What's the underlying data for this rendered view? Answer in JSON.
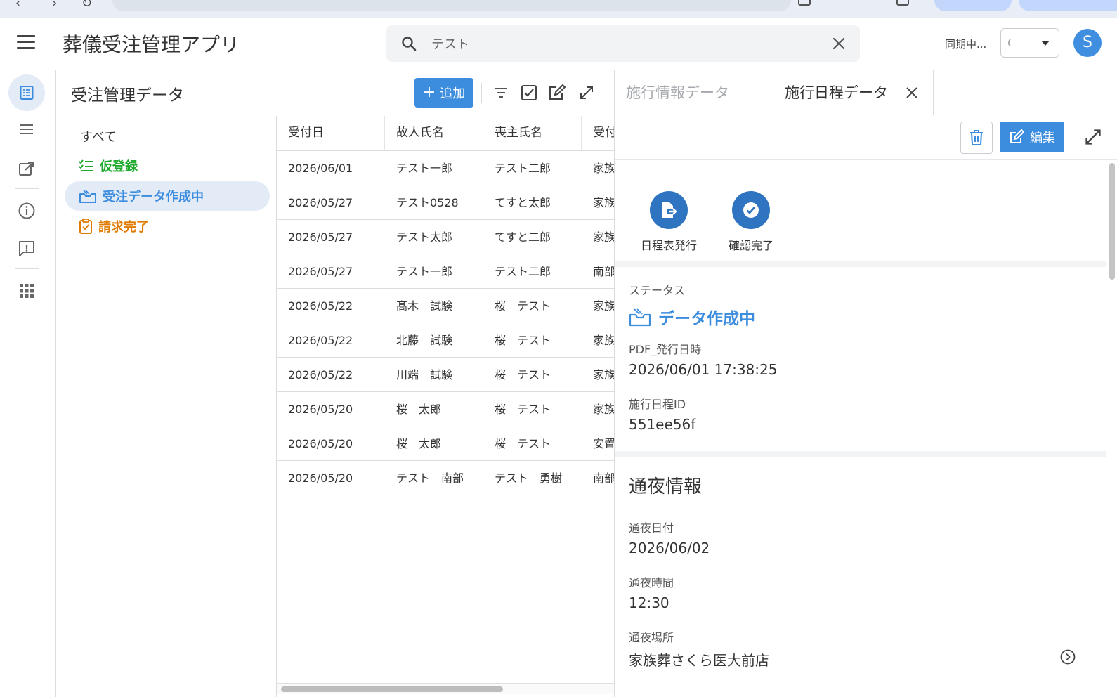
{
  "app": {
    "title": "葬儀受注管理アプリ"
  },
  "search": {
    "value": "テスト"
  },
  "sync": {
    "status": "同期中..."
  },
  "user": {
    "avatar_initial": "S"
  },
  "list_view": {
    "title": "受注管理データ",
    "add_label": "追加",
    "folders": [
      {
        "label": "すべて"
      },
      {
        "label": "仮登録"
      },
      {
        "label": "受注データ作成中"
      },
      {
        "label": "請求完了"
      }
    ],
    "columns": [
      "受付日",
      "故人氏名",
      "喪主氏名",
      "受付"
    ],
    "rows": [
      [
        "2026/06/01",
        "テスト一郎",
        "テスト二郎",
        "家族"
      ],
      [
        "2026/05/27",
        "テスト0528",
        "てすと太郎",
        "家族"
      ],
      [
        "2026/05/27",
        "テスト太郎",
        "てすと二郎",
        "家族"
      ],
      [
        "2026/05/27",
        "テスト一郎",
        "テスト二郎",
        "南部"
      ],
      [
        "2026/05/22",
        "髙木　試験",
        "桜　テスト",
        "家族"
      ],
      [
        "2026/05/22",
        "北藤　試験",
        "桜　テスト",
        "家族"
      ],
      [
        "2026/05/22",
        "川端　試験",
        "桜　テスト",
        "家族"
      ],
      [
        "2026/05/20",
        "桜　太郎",
        "桜　テスト",
        "家族"
      ],
      [
        "2026/05/20",
        "桜　太郎",
        "桜　テスト",
        "安置"
      ],
      [
        "2026/05/20",
        "テスト　南部",
        "テスト　勇樹",
        "南部"
      ]
    ]
  },
  "detail": {
    "tabs": [
      {
        "label": "施行情報データ"
      },
      {
        "label": "施行日程データ"
      }
    ],
    "edit_label": "編集",
    "actions": [
      {
        "label": "日程表発行"
      },
      {
        "label": "確認完了"
      }
    ],
    "status_label": "ステータス",
    "status_value": "データ作成中",
    "pdf_label": "PDF_発行日時",
    "pdf_value": "2026/06/01 17:38:25",
    "id_label": "施行日程ID",
    "id_value": "551ee56f",
    "wake_section_title": "通夜情報",
    "wake_date_label": "通夜日付",
    "wake_date_value": "2026/06/02",
    "wake_time_label": "通夜時間",
    "wake_time_value": "12:30",
    "wake_place_label": "通夜場所",
    "wake_place_value": "家族葬さくら医大前店"
  },
  "colors": {
    "accent": "#3d8ddf",
    "green": "#1faa2e",
    "orange": "#e07a00",
    "action_circle": "#2f74c0"
  }
}
